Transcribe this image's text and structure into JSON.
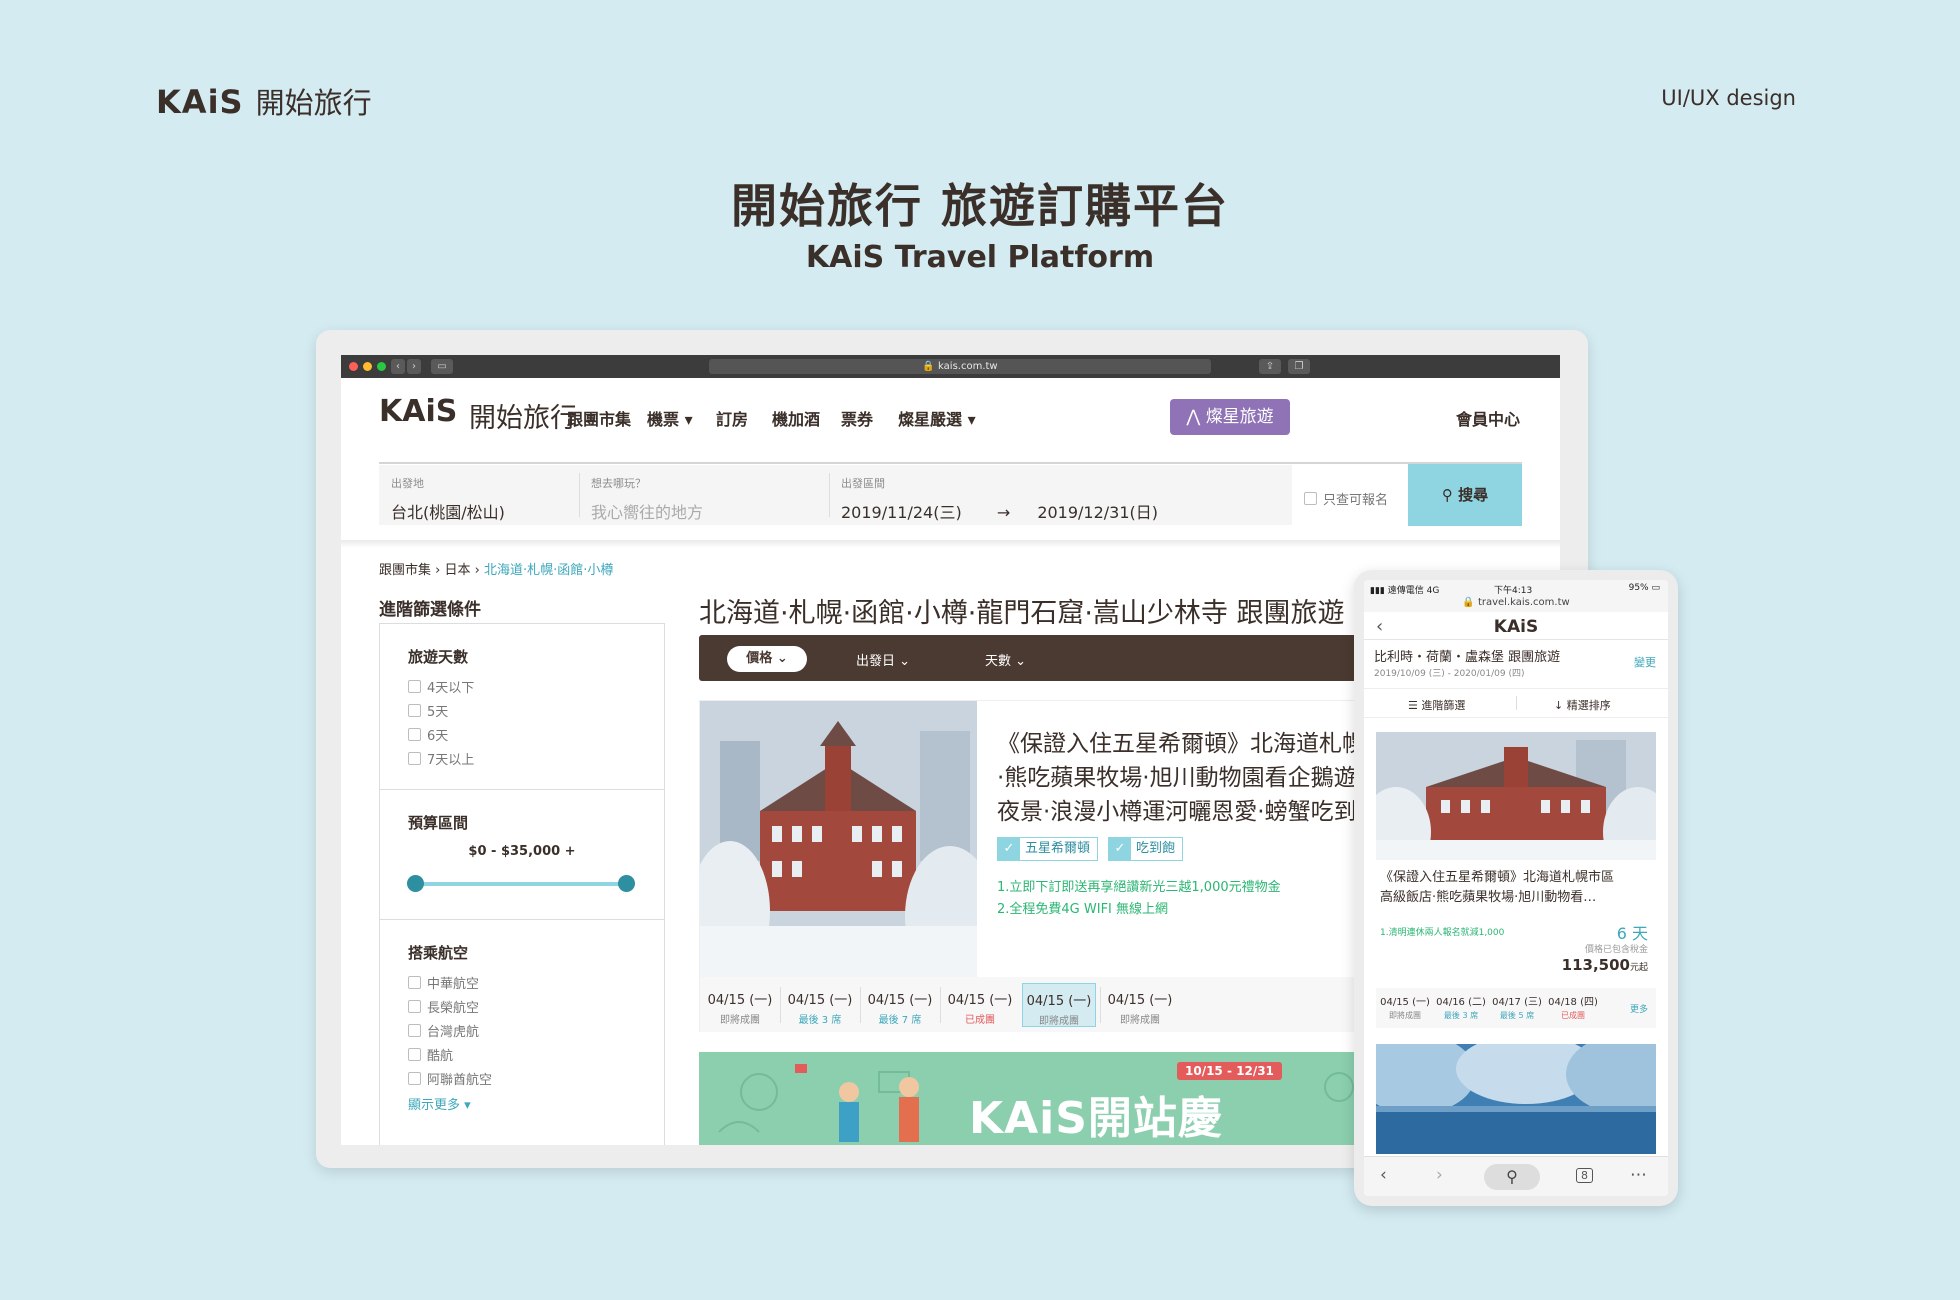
{
  "slide": {
    "brand_logo": "KAiS",
    "brand_name": "開始旅行",
    "discipline": "UI/UX design",
    "title": "開始旅行 旅遊訂購平台",
    "subtitle": "KAiS Travel Platform"
  },
  "browser": {
    "url": "kais.com.tw"
  },
  "nav": {
    "logo": "KAiS",
    "logo_cn": "開始旅行",
    "items": [
      "跟團市集",
      "機票",
      "訂房",
      "機加酒",
      "票券",
      "燦星嚴選"
    ],
    "cta": "燦星旅遊",
    "member": "會員中心"
  },
  "search": {
    "origin_label": "出發地",
    "origin_value": "台北(桃園/松山)",
    "dest_label": "想去哪玩？",
    "dest_placeholder": "我心嚮往的地方",
    "date_label": "出發區間",
    "date_from": "2019/11/24(三)",
    "date_to": "2019/12/31(日)",
    "only_open_label": "只查可報名",
    "button": "搜尋"
  },
  "breadcrumb": [
    "跟團市集",
    "日本",
    "北海道·札幌·函館·小樽"
  ],
  "filters": {
    "title": "進階篩選條件",
    "days_title": "旅遊天數",
    "days": [
      "4天以下",
      "5天",
      "6天",
      "7天以上"
    ],
    "budget_title": "預算區間",
    "budget_range": "$0 - $35,000 +",
    "airline_title": "搭乘航空",
    "airlines": [
      "中華航空",
      "長榮航空",
      "台灣虎航",
      "酷航",
      "阿聯酋航空"
    ],
    "show_more": "顯示更多"
  },
  "results": {
    "title": "北海道·札幌·函館·小樽·龍門石窟·嵩山少林寺 跟團旅遊",
    "sort": [
      "價格",
      "出發日",
      "天數"
    ],
    "card": {
      "lines": [
        "《保證入住五星希爾頓》北海道札幌",
        "·熊吃蘋果牧場·旭川動物園看企鵝遊",
        "夜景·浪漫小樽運河曬恩愛·螃蟹吃到"
      ],
      "tags": [
        "五星希爾頓",
        "吃到飽"
      ],
      "promos": [
        "1.立即下訂即送再享絕讚新光三越1,000元禮物金",
        "2.全程免費4G WIFI 無線上網"
      ],
      "dates": [
        {
          "date": "04/15 (一)",
          "status": "即將成團",
          "tone": "gray"
        },
        {
          "date": "04/15 (一)",
          "status": "最後 3 席",
          "tone": "blue"
        },
        {
          "date": "04/15 (一)",
          "status": "最後 7 席",
          "tone": "blue"
        },
        {
          "date": "04/15 (一)",
          "status": "已成團",
          "tone": "red"
        },
        {
          "date": "04/15 (一)",
          "status": "即將成團",
          "tone": "gray"
        },
        {
          "date": "04/15 (一)",
          "status": "即將成團",
          "tone": "gray"
        }
      ]
    },
    "banner": {
      "text": "KAiS開站慶",
      "date": "10/15 - 12/31"
    }
  },
  "phone": {
    "carrier": "遠傳電信",
    "network": "4G",
    "time": "下午4:13",
    "battery": "95%",
    "url": "travel.kais.com.tw",
    "logo": "KAiS",
    "route": "比利時・荷蘭・盧森堡 跟團旅遊",
    "range": "2019/10/09 (三) - 2020/01/09 (四)",
    "change": "變更",
    "filter": "進階篩選",
    "sort": "精選排序",
    "desc": [
      "《保證入住五星希爾頓》北海道札幌市區",
      "高級飯店·熊吃蘋果牧場·旭川動物看…"
    ],
    "promo": "1.清明連休兩人報名就減1,000",
    "days": "6 天",
    "tax_note": "價格已包含稅金",
    "price": "113,500",
    "price_unit": "元起",
    "dates": [
      {
        "date": "04/15 (一)",
        "status": "即將成團",
        "tone": "gray"
      },
      {
        "date": "04/16 (二)",
        "status": "最後 3 席",
        "tone": "blue"
      },
      {
        "date": "04/17 (三)",
        "status": "最後 5 席",
        "tone": "blue"
      },
      {
        "date": "04/18 (四)",
        "status": "已成團",
        "tone": "red"
      }
    ],
    "more": "更多",
    "tab_count": "8"
  },
  "colors": {
    "background": "#d3ebf1",
    "brown": "#4b3a31",
    "purple": "#8f73b6",
    "teal": "#8fd4e1",
    "green": "#2bb673",
    "red": "#e35b5b"
  }
}
